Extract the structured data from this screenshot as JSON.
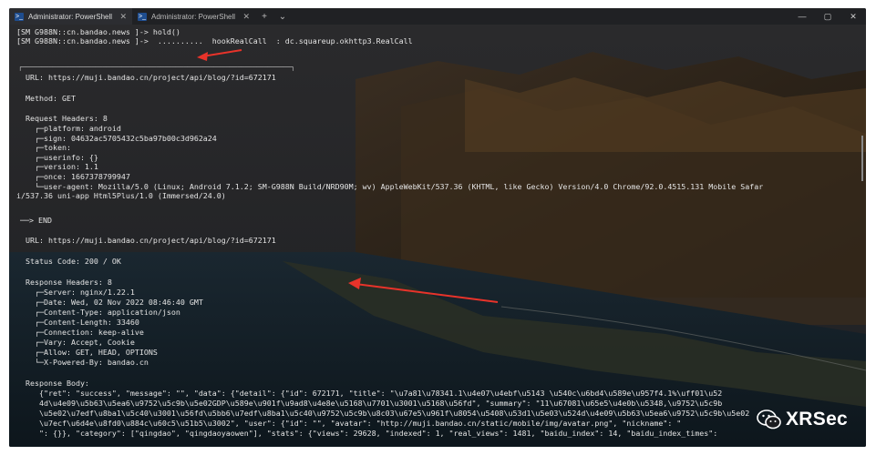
{
  "tabs": [
    {
      "label": "Administrator: PowerShell",
      "close": "✕"
    },
    {
      "label": "Administrator: PowerShell",
      "close": "✕"
    }
  ],
  "toolbar": {
    "new_tab": "+",
    "dropdown": "⌄"
  },
  "window_controls": {
    "minimize": "—",
    "maximize": "▢",
    "close": "✕"
  },
  "terminal": {
    "prompt1": "[SM G988N::cn.bandao.news ]-> ",
    "cmd1": "hold()",
    "prompt2": "[SM G988N::cn.bandao.news ]-> ",
    "cmd2": " ..........  hookRealCall  : dc.squareup.okhttp3.RealCall",
    "box_top": "┌──────────────────────────────────────────────────────────────────────┐",
    "req_url": "URL: https://muji.bandao.cn/project/api/blog/?id=672171",
    "method": "Method: GET",
    "req_headers_title": "Request Headers: 8",
    "req_headers": [
      "  ┌─platform: android",
      "  ┌─sign: 04632ac5705432c5ba97b00c3d962a24",
      "  ┌─token:",
      "  ┌─userinfo: {}",
      "  ┌─version: 1.1",
      "  ┌─once: 1667378799947",
      "  └─user-agent: Mozilla/5.0 (Linux; Android 7.1.2; SM-G988N Build/NRD90M; wv) AppleWebKit/537.36 (KHTML, like Gecko) Version/4.0 Chrome/92.0.4515.131 Mobile Safar",
      "i/537.36 uni-app Html5Plus/1.0 (Immersed/24.0)"
    ],
    "end_line": "──> END",
    "resp_url": "URL: https://muji.bandao.cn/project/api/blog/?id=672171",
    "status": "Status Code: 200 / OK",
    "resp_headers_title": "Response Headers: 8",
    "resp_headers": [
      "  ┌─Server: nginx/1.22.1",
      "  ┌─Date: Wed, 02 Nov 2022 08:46:40 GMT",
      "  ┌─Content-Type: application/json",
      "  ┌─Content-Length: 33460",
      "  ┌─Connection: keep-alive",
      "  ┌─Vary: Accept, Cookie",
      "  ┌─Allow: GET, HEAD, OPTIONS",
      "  └─X-Powered-By: bandao.cn"
    ],
    "body_title": "Response Body:",
    "body_lines": [
      "   {\"ret\": \"success\", \"message\": \"\", \"data\": {\"detail\": {\"id\": 672171, \"title\": \"\\u7a81\\u78341.1\\u4e07\\u4ebf\\u5143 \\u540c\\u6bd4\\u589e\\u957f4.1%\\uff01\\u52",
      "   4d\\u4e09\\u5b63\\u5ea6\\u9752\\u5c9b\\u5e02GDP\\u589e\\u901f\\u9ad8\\u4e8e\\u5168\\u7701\\u3001\\u5168\\u56fd\", \"summary\": \"11\\u67081\\u65e5\\u4e0b\\u5348,\\u9752\\u5c9b",
      "   \\u5e02\\u7edf\\u8ba1\\u5c40\\u3001\\u56fd\\u5bb6\\u7edf\\u8ba1\\u5c40\\u9752\\u5c9b\\u8c03\\u67e5\\u961f\\u8054\\u5408\\u53d1\\u5e03\\u524d\\u4e09\\u5b63\\u5ea6\\u9752\\u5c9b\\u5e02",
      "   \\u7ecf\\u6d4e\\u8fd0\\u884c\\u60c5\\u51b5\\u3002\", \"user\": {\"id\": \"\", \"avatar\": \"http://muji.bandao.cn/static/mobile/img/avatar.png\", \"nickname\": \"",
      "   \": {}}, \"category\": [\"qingdao\", \"qingdaoyaowen\"], \"stats\": {\"views\": 29628, \"indexed\": 1, \"real_views\": 1481, \"baidu_index\": 14, \"baidu_index_times\": "
    ]
  },
  "watermark": {
    "text": "XRSec"
  },
  "colors": {
    "accent_arrow": "#e8332a",
    "window_bg": "#1c1d20"
  }
}
